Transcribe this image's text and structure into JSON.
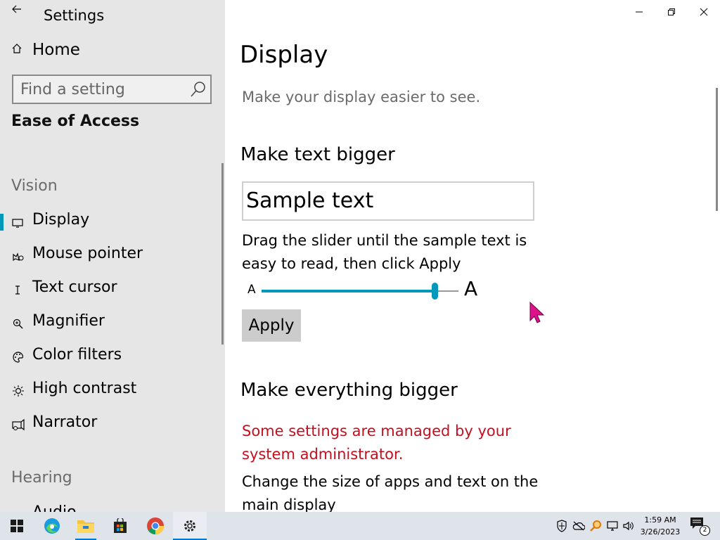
{
  "window": {
    "title": "Settings",
    "back_icon": "back-arrow-icon",
    "controls": [
      "minimize-icon",
      "restore-icon",
      "close-icon"
    ]
  },
  "sidebar": {
    "home_label": "Home",
    "search_placeholder": "Find a setting",
    "section_title": "Ease of Access",
    "vision_label": "Vision",
    "items": [
      {
        "label": "Display",
        "icon": "monitor-icon",
        "selected": true
      },
      {
        "label": "Mouse pointer",
        "icon": "mouse-pointer-icon"
      },
      {
        "label": "Text cursor",
        "icon": "text-cursor-icon"
      },
      {
        "label": "Magnifier",
        "icon": "magnifier-icon"
      },
      {
        "label": "Color filters",
        "icon": "color-filters-icon"
      },
      {
        "label": "High contrast",
        "icon": "high-contrast-icon"
      },
      {
        "label": "Narrator",
        "icon": "narrator-icon"
      }
    ],
    "hearing_label": "Hearing",
    "partial_item": "Audio"
  },
  "main": {
    "title": "Display",
    "subtitle": "Make your display easier to see.",
    "text_bigger_heading": "Make text bigger",
    "sample_text": "Sample text",
    "slider_instructions": "Drag the slider until the sample text is easy to read, then click Apply",
    "slider_min_label": "A",
    "slider_max_label": "A",
    "slider_value_fraction": 0.88,
    "apply_label": "Apply",
    "everything_bigger_heading": "Make everything bigger",
    "admin_warning": "Some settings are managed by your system administrator.",
    "change_size_text": "Change the size of apps and text on the main display",
    "accent_color": "#0099bc",
    "warning_color": "#c50f1f"
  },
  "taskbar": {
    "apps": [
      "windows-start-icon",
      "edge-icon",
      "file-explorer-icon",
      "store-icon",
      "chrome-icon",
      "settings-icon"
    ],
    "tray_icons": [
      "security-shield-icon",
      "onedrive-icon",
      "search-key-icon",
      "network-icon",
      "volume-icon"
    ],
    "time": "1:59 AM",
    "date": "3/26/2023",
    "notification_count": "2"
  }
}
